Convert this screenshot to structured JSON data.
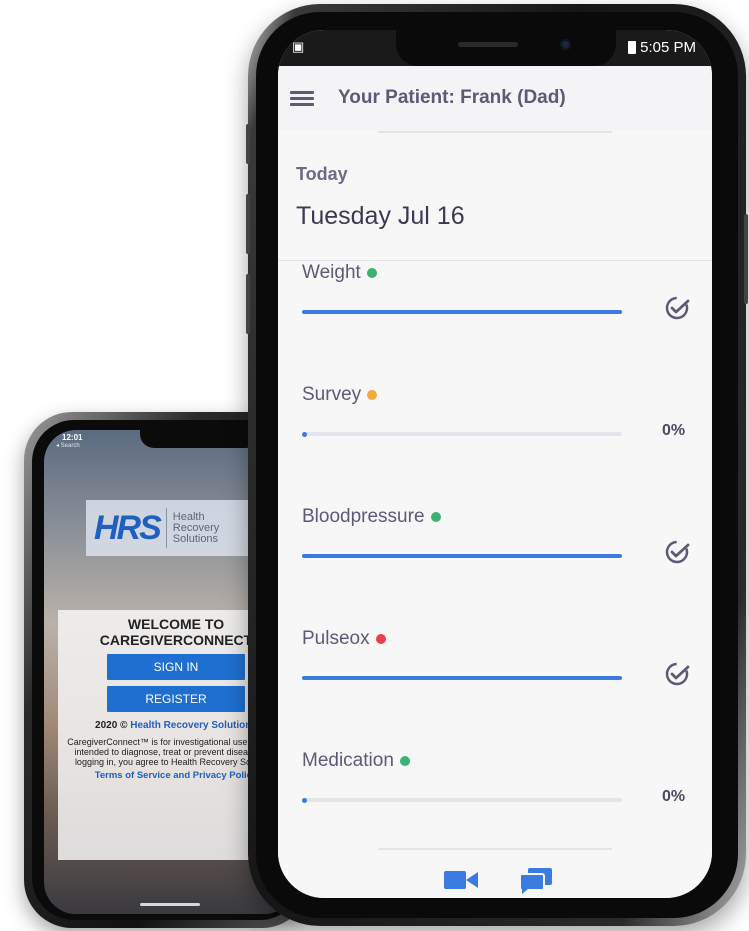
{
  "small_phone": {
    "status_time": "12:01",
    "back_label": "◂ Search",
    "logo": {
      "mark": "HRS",
      "line1": "Health",
      "line2": "Recovery",
      "line3": "Solutions"
    },
    "welcome_line1": "WELCOME TO",
    "welcome_line2": "CAREGIVERCONNECT",
    "sign_in_label": "SIGN IN",
    "register_label": "REGISTER",
    "copyright_prefix": "2020 ©",
    "copyright_link": "Health Recovery Solutions",
    "disclaimer": "CaregiverConnect™ is for investigational use only. Not intended to diagnose, treat or prevent diseases. By logging in, you agree to Health Recovery Solutions",
    "terms_link": "Terms of Service and Privacy Policy"
  },
  "large_phone": {
    "status": {
      "time": "5:05 PM"
    },
    "header": {
      "title": "Your Patient: Frank (Dad)"
    },
    "today": {
      "label": "Today",
      "date": "Tuesday Jul 16"
    },
    "metrics": [
      {
        "name": "Weight",
        "dot_color": "#3bb273",
        "progress": 1.0,
        "done": true,
        "percent_text": ""
      },
      {
        "name": "Survey",
        "dot_color": "#f2a93b",
        "progress": 0.0,
        "done": false,
        "percent_text": "0%"
      },
      {
        "name": "Bloodpressure",
        "dot_color": "#3bb273",
        "progress": 1.0,
        "done": true,
        "percent_text": ""
      },
      {
        "name": "Pulseox",
        "dot_color": "#e8414a",
        "progress": 1.0,
        "done": true,
        "percent_text": ""
      },
      {
        "name": "Medication",
        "dot_color": "#3bb273",
        "progress": 0.0,
        "done": false,
        "percent_text": "0%"
      }
    ],
    "nav_icons": [
      "video-call-icon",
      "chat-icon"
    ],
    "accent_color": "#3a7be2"
  }
}
